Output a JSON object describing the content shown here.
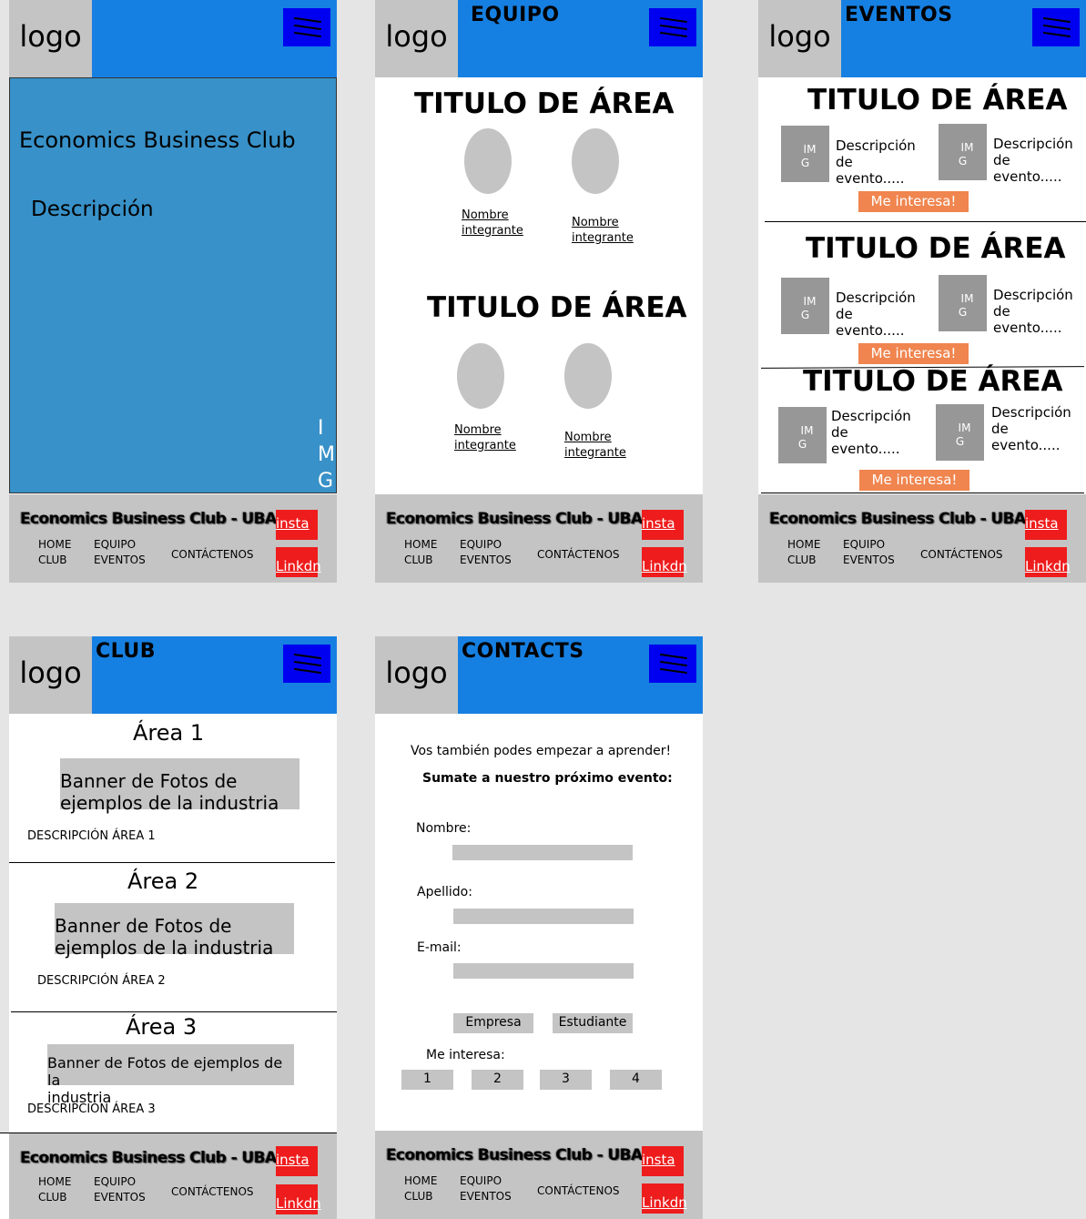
{
  "common": {
    "logo": "logo",
    "footer_title": "Economics Business Club - UBA",
    "nav": {
      "home": [
        "HOME",
        "CLUB"
      ],
      "equipo": [
        "EQUIPO",
        "EVENTOS"
      ],
      "contact": "CONTÁCTENOS"
    },
    "insta": "insta",
    "linkdn": "Linkdn"
  },
  "home": {
    "club_name": "Economics Business Club",
    "description": "Descripción",
    "img_letters": [
      "I",
      "M",
      "G"
    ]
  },
  "equipo": {
    "title": "EQUIPO",
    "areas": [
      {
        "title": "TITULO DE ÁREA",
        "members": [
          [
            "Nombre",
            "integrante"
          ],
          [
            "Nombre",
            "integrante"
          ]
        ]
      },
      {
        "title": "TITULO DE ÁREA",
        "members": [
          [
            "Nombre",
            "integrante"
          ],
          [
            "Nombre",
            "integrante"
          ]
        ]
      }
    ]
  },
  "eventos": {
    "title": "EVENTOS",
    "img_label": [
      "IM",
      "G"
    ],
    "event_desc": [
      "Descripción",
      "de",
      "evento....."
    ],
    "button": "Me interesa!",
    "areas": [
      "TITULO DE ÁREA",
      "TITULO DE ÁREA",
      "TITULO DE ÁREA"
    ]
  },
  "club": {
    "title": "CLUB",
    "areas": [
      {
        "name": "Área 1",
        "banner": [
          "Banner de Fotos de",
          "ejemplos de la industria"
        ],
        "desc": "DESCRIPCIÓN ÁREA 1"
      },
      {
        "name": "Área 2",
        "banner": [
          "Banner de Fotos de",
          "ejemplos de la industria"
        ],
        "desc": "DESCRIPCIÓN ÁREA 2"
      },
      {
        "name": "Área 3",
        "banner": [
          "Banner de Fotos de ejemplos de la",
          "industria"
        ],
        "desc": "DESCRIPCIÓN ÁREA 3"
      }
    ]
  },
  "contacts": {
    "title": "CONTACTS",
    "intro": "Vos también podes empezar a aprender!",
    "subtitle": "Sumate a nuestro próximo evento:",
    "fields": {
      "nombre": "Nombre:",
      "apellido": "Apellido:",
      "email": "E-mail:"
    },
    "types": [
      "Empresa",
      "Estudiante"
    ],
    "interest_label": "Me interesa:",
    "interest_options": [
      "1",
      "2",
      "3",
      "4"
    ]
  },
  "colors": {
    "header_blue": "#1680e2",
    "menu_blue": "#0000f0",
    "hero_blue": "#3891c8",
    "social_red": "#ee1c1c",
    "cta_orange": "#f0854f",
    "placeholder_gray": "#c4c4c4"
  }
}
